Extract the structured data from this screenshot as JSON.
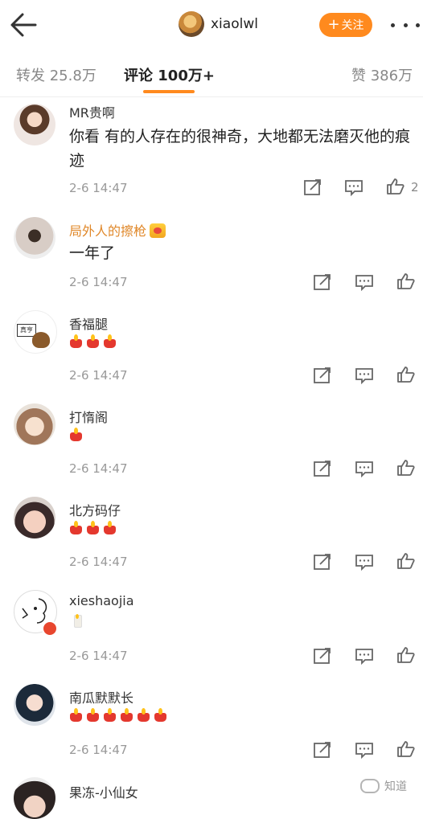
{
  "header": {
    "username": "xiaolwl",
    "follow_label": "关注",
    "follow_plus": "+"
  },
  "tabs": [
    {
      "label": "转发",
      "count": "25.8万"
    },
    {
      "label": "评论",
      "count": "100万+"
    },
    {
      "label": "赞",
      "count": "386万"
    }
  ],
  "comments": [
    {
      "name": "MR贵啊",
      "text": "你看   有的人存在的很神奇，大地都无法磨灭他的痕迹",
      "time": "2-6 14:47",
      "likes": "2"
    },
    {
      "name": "局外人的擦枪",
      "text": "一年了",
      "time": "2-6 14:47",
      "likes": ""
    },
    {
      "name": "香福腿",
      "candles": 3,
      "time": "2-6 14:47",
      "avatar_sign": "真亨"
    },
    {
      "name": "打惰阁",
      "candles": 1,
      "time": "2-6 14:47"
    },
    {
      "name": "北方码仔",
      "candles": 3,
      "time": "2-6 14:47"
    },
    {
      "name": "xieshaojia",
      "white_candle": true,
      "time": "2-6 14:47"
    },
    {
      "name": "南瓜默默长",
      "candles": 6,
      "time": "2-6 14:47"
    },
    {
      "name": "果冻-小仙女"
    }
  ],
  "watermark": "知道",
  "colors": {
    "accent": "#ff8a1e",
    "vip_name": "#e0882a",
    "candle": "#e4382e"
  },
  "icons": [
    "back-arrow-icon",
    "more-dots-icon",
    "repost-icon",
    "comment-icon",
    "like-icon",
    "candle-icon"
  ]
}
